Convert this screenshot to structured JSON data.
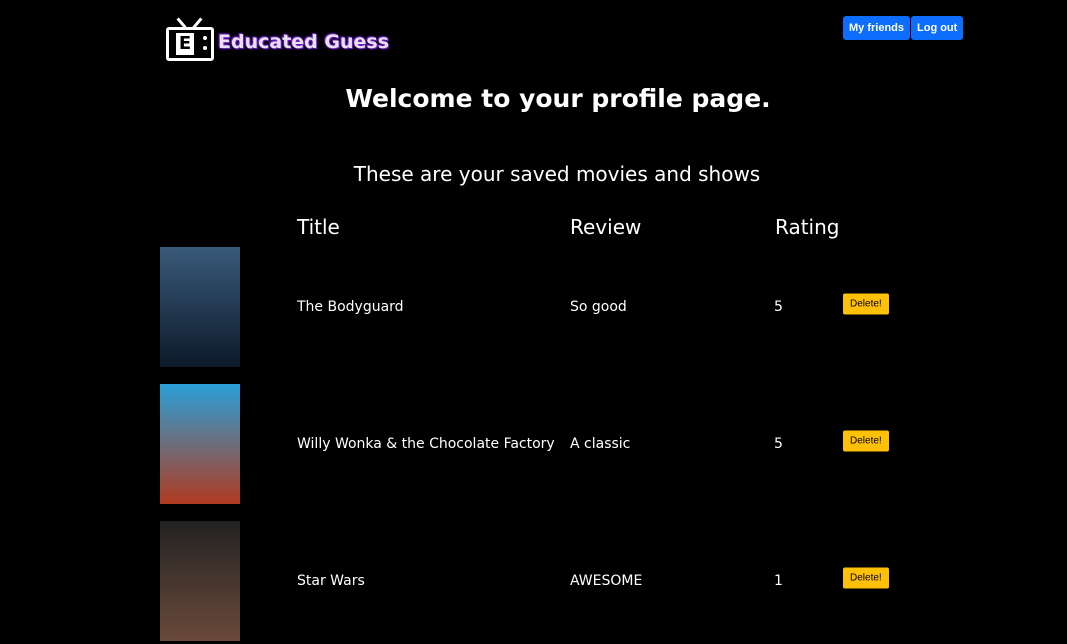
{
  "brand": {
    "name": "Educated Guess",
    "logo_letter": "E"
  },
  "nav": {
    "friends": "My friends",
    "logout": "Log out"
  },
  "heading": "Welcome to your profile page.",
  "subheading": "These are your saved movies and shows",
  "table": {
    "headers": [
      "Title",
      "Review",
      "Rating"
    ],
    "rows": [
      {
        "title": "The Bodyguard",
        "review": "So good",
        "rating": "5",
        "delete": "Delete!",
        "poster_colors": [
          "#3a5a7a",
          "#0c1a2a"
        ]
      },
      {
        "title": "Willy Wonka & the Chocolate Factory",
        "review": "A classic",
        "rating": "5",
        "delete": "Delete!",
        "poster_colors": [
          "#2aa0d8",
          "#b03a20"
        ]
      },
      {
        "title": "Star Wars",
        "review": "AWESOME",
        "rating": "1",
        "delete": "Delete!",
        "poster_colors": [
          "#222",
          "#6a4a3a"
        ]
      }
    ]
  },
  "colors": {
    "primary": "#0d6efd",
    "warning": "#ffc107",
    "logo_glow": "#6a1fc2"
  }
}
